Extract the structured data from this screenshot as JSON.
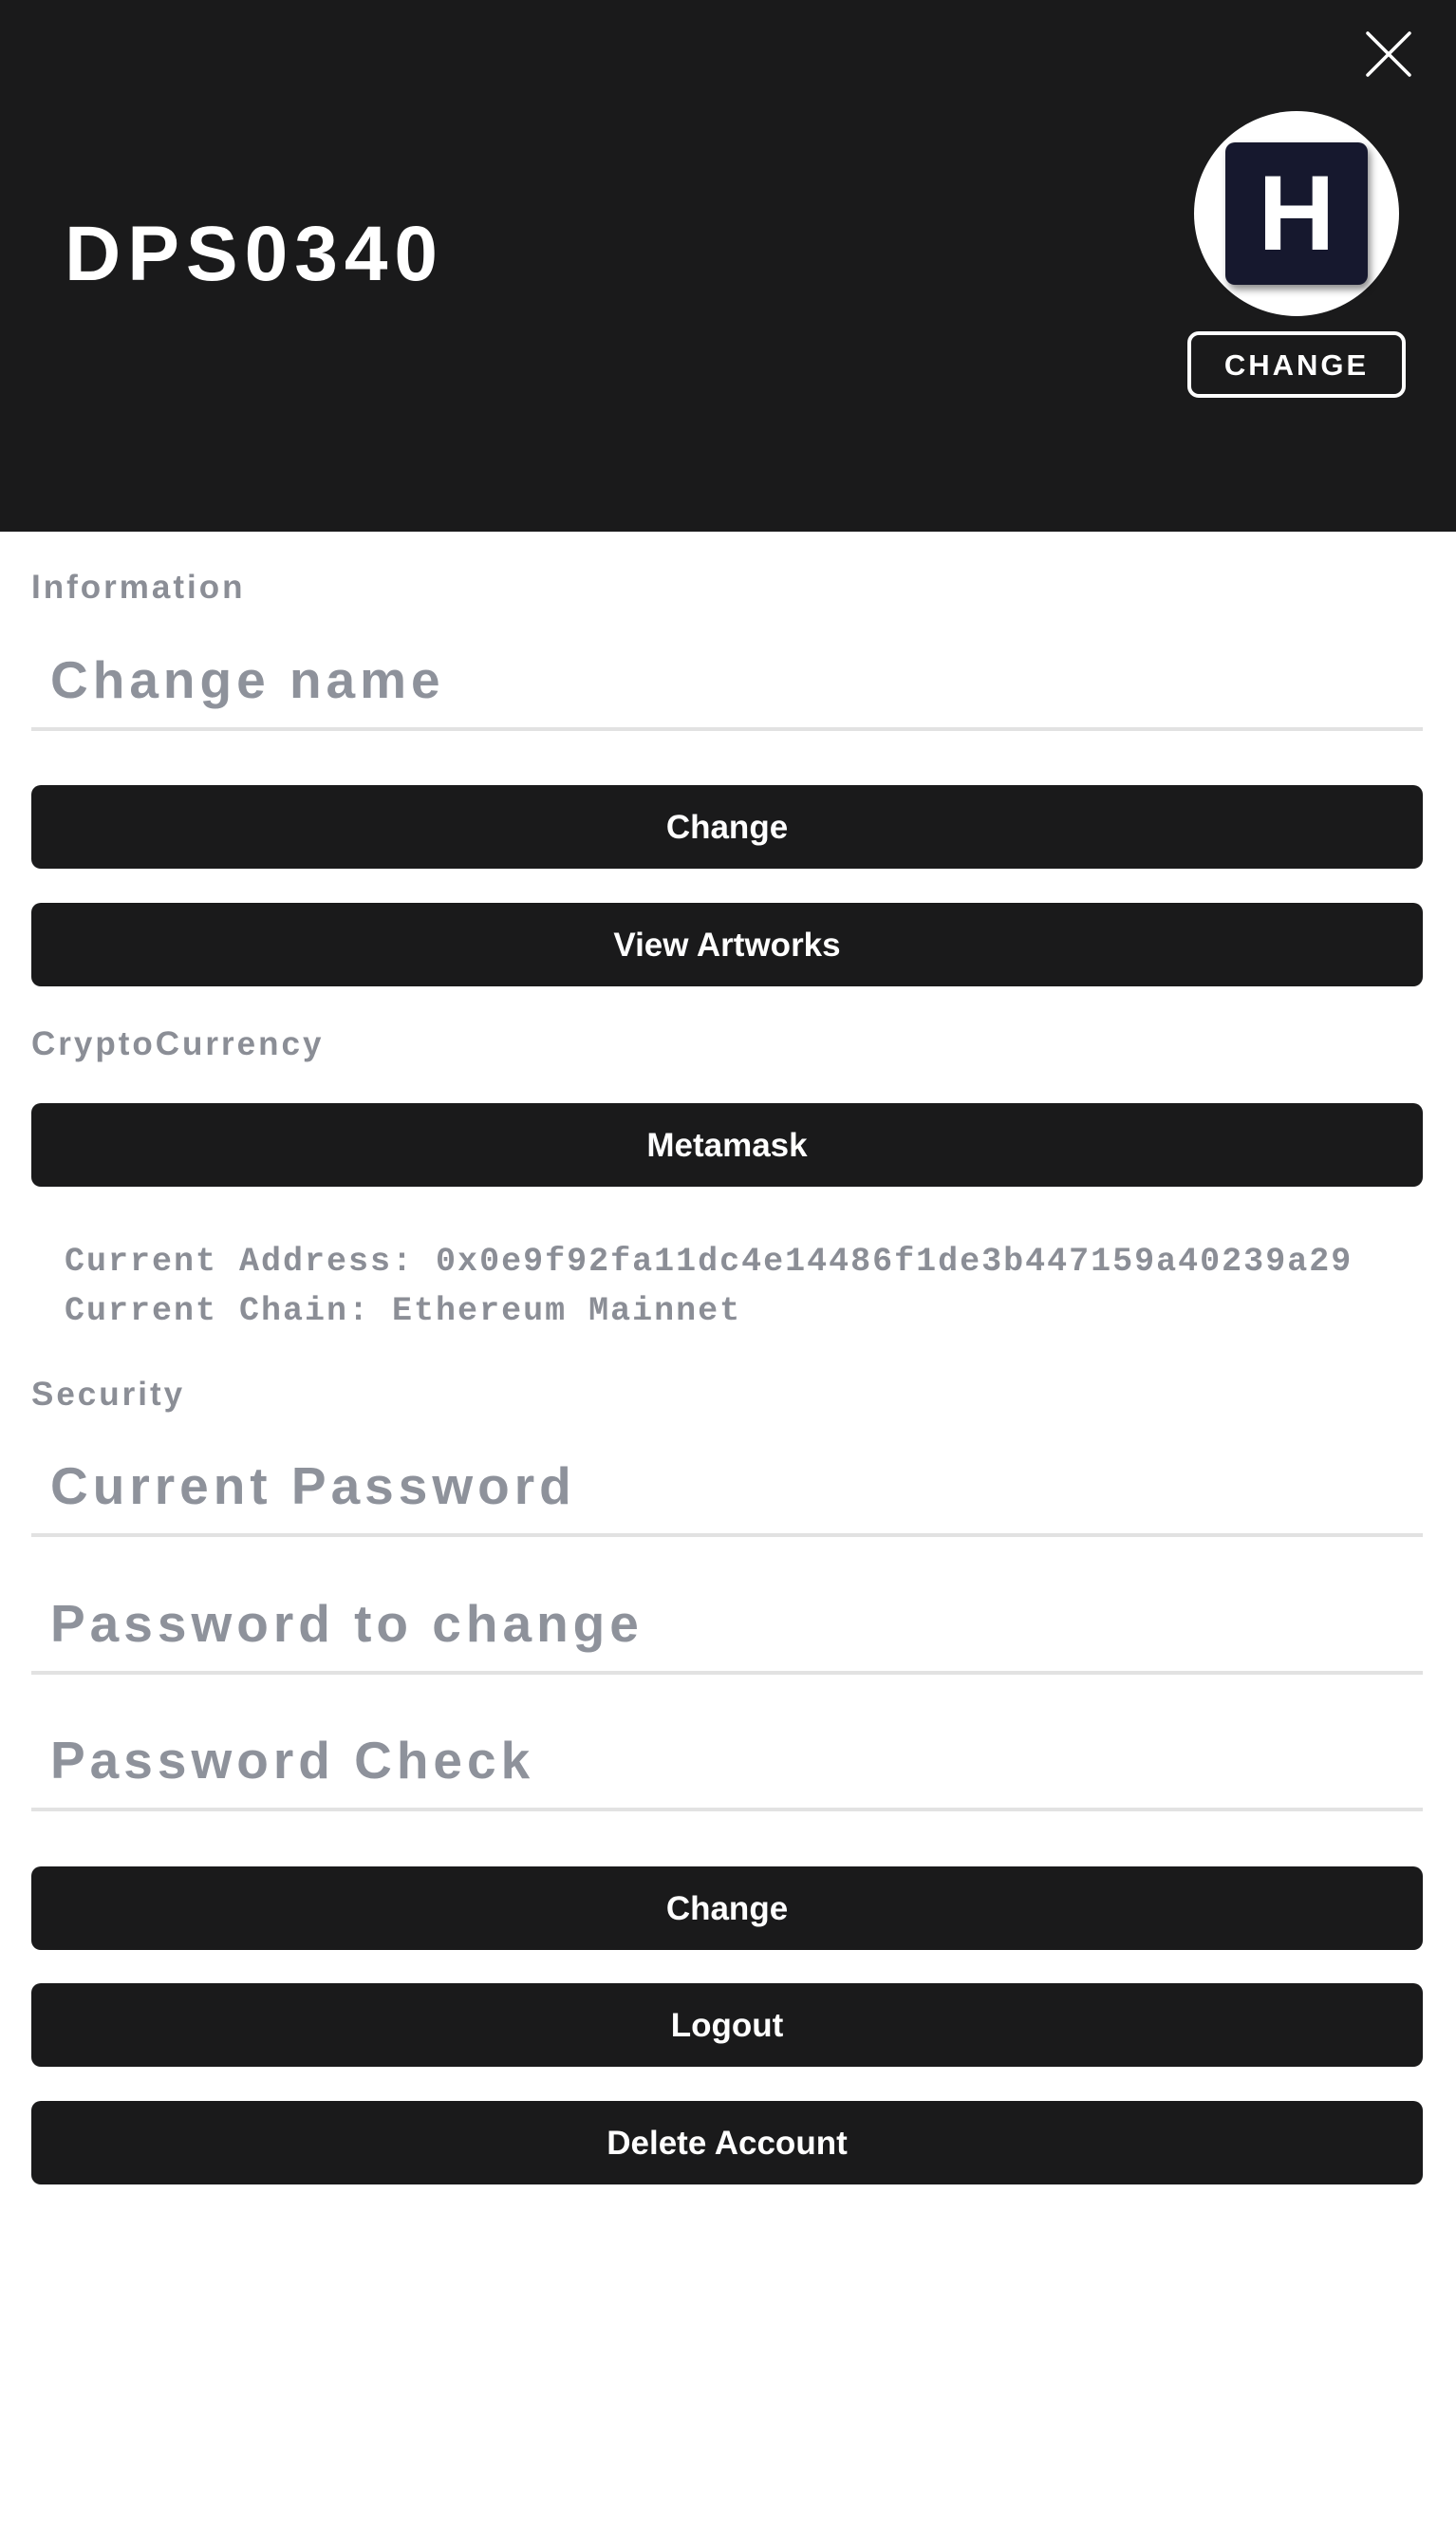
{
  "header": {
    "username": "DPS0340",
    "avatar_letter": "H",
    "avatar_change_label": "CHANGE"
  },
  "information": {
    "section_label": "Information",
    "name_placeholder": "Change name",
    "change_label": "Change",
    "view_artworks_label": "View Artworks"
  },
  "crypto": {
    "section_label": "CryptoCurrency",
    "metamask_label": "Metamask",
    "current_address": "Current Address: 0x0e9f92fa11dc4e14486f1de3b447159a40239a29",
    "current_chain": "Current Chain: Ethereum Mainnet"
  },
  "security": {
    "section_label": "Security",
    "current_password_placeholder": "Current Password",
    "new_password_placeholder": "Password to change",
    "password_check_placeholder": "Password Check",
    "change_label": "Change",
    "logout_label": "Logout",
    "delete_account_label": "Delete Account"
  },
  "colors": {
    "header_bg": "#1a1a1b",
    "button_bg": "#1a1a1b",
    "label_gray": "#8b8e96",
    "avatar_bg": "#16182e",
    "divider": "#e2e2e2"
  },
  "icons": {
    "close": "close-icon"
  }
}
